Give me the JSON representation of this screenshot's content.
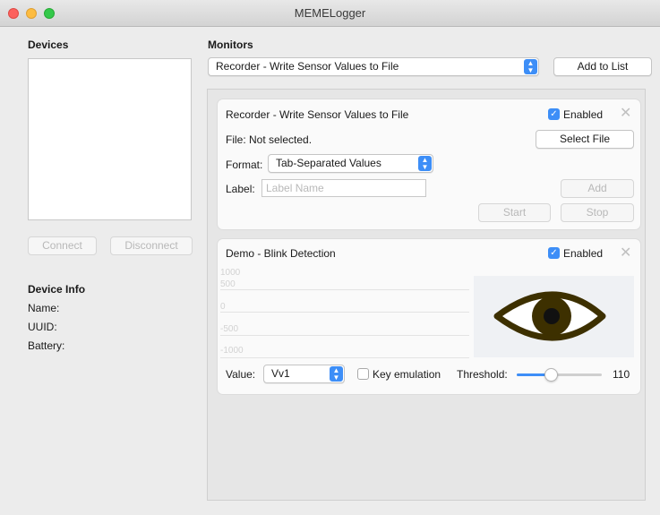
{
  "window": {
    "title": "MEMELogger"
  },
  "devices": {
    "heading": "Devices",
    "connect_label": "Connect",
    "disconnect_label": "Disconnect",
    "info_heading": "Device Info",
    "name_label": "Name:",
    "uuid_label": "UUID:",
    "battery_label": "Battery:"
  },
  "monitors": {
    "heading": "Monitors",
    "selected_monitor": "Recorder - Write Sensor Values to File",
    "add_label": "Add to List"
  },
  "recorder": {
    "title": "Recorder - Write Sensor Values to File",
    "enabled_label": "Enabled",
    "enabled": true,
    "file_text": "File:  Not selected.",
    "select_file_label": "Select File",
    "format_label": "Format:",
    "format_value": "Tab-Separated Values",
    "label_label": "Label:",
    "label_placeholder": "Label Name",
    "add_label": "Add",
    "start_label": "Start",
    "stop_label": "Stop"
  },
  "blink": {
    "title": "Demo - Blink Detection",
    "enabled_label": "Enabled",
    "enabled": true,
    "ticks": [
      "1000",
      "500",
      "0",
      "-500",
      "-1000"
    ],
    "value_label": "Value:",
    "value_selected": "Vv1",
    "key_emulation_label": "Key emulation",
    "key_emulation": false,
    "threshold_label": "Threshold:",
    "threshold_value": "110",
    "threshold_fraction": 0.4
  },
  "icons": {
    "close": "close-icon",
    "eye": "eye-icon",
    "check": "checkmark-icon",
    "updown": "chevron-updown-icon"
  },
  "colors": {
    "accent": "#3d8ef7",
    "eye": "#3d3000"
  }
}
